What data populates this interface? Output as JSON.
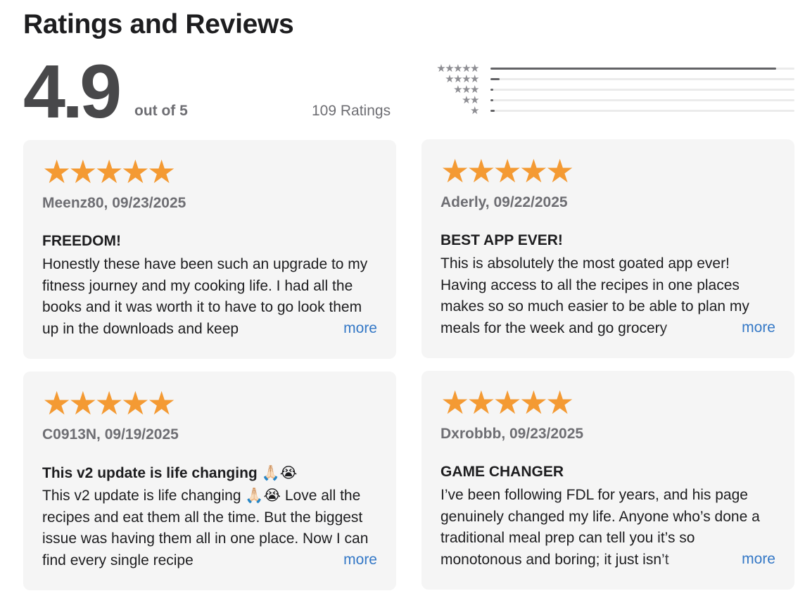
{
  "heading": "Ratings and Reviews",
  "summary": {
    "average": "4.9",
    "out_of": "out of 5",
    "count": "109 Ratings"
  },
  "histogram": [
    {
      "stars": "★★★★★",
      "fraction": 0.94
    },
    {
      "stars": "★★★★",
      "fraction": 0.03
    },
    {
      "stars": "★★★",
      "fraction": 0.005
    },
    {
      "stars": "★★",
      "fraction": 0.005
    },
    {
      "stars": "★",
      "fraction": 0.015
    }
  ],
  "reviews": [
    {
      "stars": "★★★★★",
      "rating": 5,
      "meta": "Meenz80, 09/23/2025",
      "title": "FREEDOM!",
      "body": "Honestly these have been such an upgrade to my fitness journey and my cooking life. I had all the books and it was worth it to have to go look them up in the downloads and keep",
      "more": "more"
    },
    {
      "stars": "★★★★★",
      "rating": 5,
      "meta": "Aderly, 09/22/2025",
      "title": "BEST APP EVER!",
      "body": "This is absolutely the most goated app ever! Having access to all the recipes in one places makes so so much easier to be able to plan my meals for the week and go grocery",
      "more": "more"
    },
    {
      "stars": "★★★★★",
      "rating": 5,
      "meta": "C0913N, 09/19/2025",
      "title": "This v2 update is life changing 🙏🏻😭",
      "body": "This v2 update is life changing 🙏🏻😭 Love all the recipes and eat them all the time. But the biggest issue was having them all in one place. Now I can find every single recipe",
      "more": "more"
    },
    {
      "stars": "★★★★★",
      "rating": 5,
      "meta": "Dxrobbb, 09/23/2025",
      "title": "GAME CHANGER",
      "body": "I’ve been following FDL for years, and his page genuinely changed my life. Anyone who’s done a traditional meal prep can tell you it’s so monotonous and boring; it just isn’t",
      "more": "more"
    }
  ],
  "colors": {
    "star": "#f49a33",
    "link": "#3478c6",
    "card_bg": "#f5f5f5"
  }
}
